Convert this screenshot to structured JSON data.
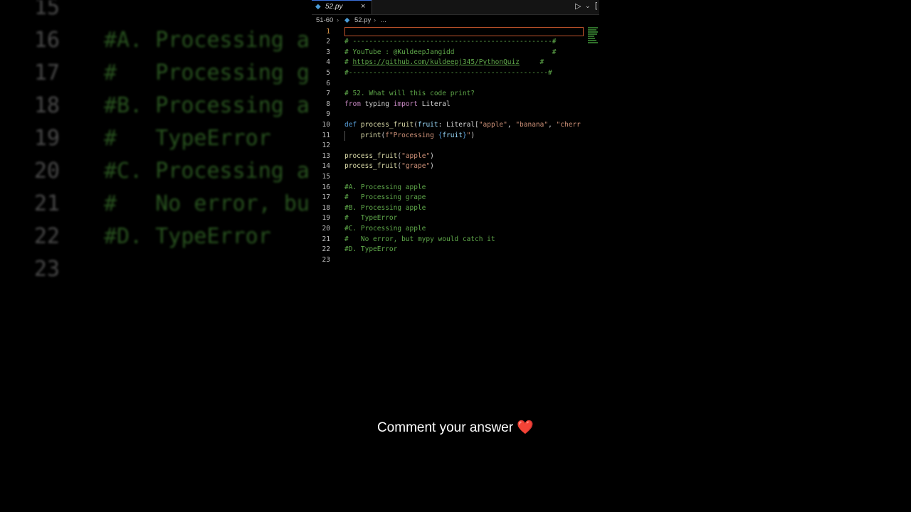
{
  "background": {
    "lines": [
      {
        "num": "15",
        "code": ""
      },
      {
        "num": "16",
        "code": "#A. Processing a"
      },
      {
        "num": "17",
        "code": "#   Processing g"
      },
      {
        "num": "18",
        "code": "#B. Processing a"
      },
      {
        "num": "19",
        "code": "#   TypeError"
      },
      {
        "num": "20",
        "code": "#C. Processing a"
      },
      {
        "num": "21",
        "code": "#   No error, bu"
      },
      {
        "num": "22",
        "code": "#D. TypeError"
      },
      {
        "num": "23",
        "code": ""
      }
    ]
  },
  "editor": {
    "tab": {
      "icon": "python-file-icon",
      "label": "52.py",
      "close": "×"
    },
    "toolbar": {
      "run": "▷",
      "run_caret": "⌄",
      "split": "[",
      "accent": "#3a6fd8"
    },
    "breadcrumb": {
      "folder": "51-60",
      "sep": "›",
      "file": "52.py",
      "rest": "..."
    },
    "lines": [
      {
        "n": "1",
        "active": true,
        "segments": []
      },
      {
        "n": "2",
        "segments": [
          {
            "t": "# -------------------------------------------------#",
            "c": "c-com"
          }
        ]
      },
      {
        "n": "3",
        "segments": [
          {
            "t": "# YouTube : @KuldeepJangidd                        #",
            "c": "c-com"
          }
        ]
      },
      {
        "n": "4",
        "segments": [
          {
            "t": "# ",
            "c": "c-com"
          },
          {
            "t": "https://github.com/kuldeepj345/PythonQuiz",
            "c": "c-link"
          },
          {
            "t": "     #",
            "c": "c-com"
          }
        ]
      },
      {
        "n": "5",
        "segments": [
          {
            "t": "#-------------------------------------------------#",
            "c": "c-com"
          }
        ]
      },
      {
        "n": "6",
        "segments": []
      },
      {
        "n": "7",
        "segments": [
          {
            "t": "# 52. What will this code print?",
            "c": "c-com"
          }
        ]
      },
      {
        "n": "8",
        "segments": [
          {
            "t": "from",
            "c": "c-kw"
          },
          {
            "t": " typing ",
            "c": "c-plain"
          },
          {
            "t": "import",
            "c": "c-kw"
          },
          {
            "t": " Literal",
            "c": "c-plain"
          }
        ]
      },
      {
        "n": "9",
        "segments": []
      },
      {
        "n": "10",
        "segments": [
          {
            "t": "def",
            "c": "c-def"
          },
          {
            "t": " ",
            "c": "c-plain"
          },
          {
            "t": "process_fruit",
            "c": "c-fn"
          },
          {
            "t": "(",
            "c": "c-plain"
          },
          {
            "t": "fruit",
            "c": "c-par"
          },
          {
            "t": ": Literal[",
            "c": "c-plain"
          },
          {
            "t": "\"apple\"",
            "c": "c-str"
          },
          {
            "t": ", ",
            "c": "c-plain"
          },
          {
            "t": "\"banana\"",
            "c": "c-str"
          },
          {
            "t": ", ",
            "c": "c-plain"
          },
          {
            "t": "\"cherr",
            "c": "c-str"
          }
        ]
      },
      {
        "n": "11",
        "guide": true,
        "segments": [
          {
            "t": "    ",
            "c": "c-plain"
          },
          {
            "t": "print",
            "c": "c-fn"
          },
          {
            "t": "(",
            "c": "c-plain"
          },
          {
            "t": "f\"Processing ",
            "c": "c-str"
          },
          {
            "t": "{",
            "c": "c-def"
          },
          {
            "t": "fruit",
            "c": "c-par"
          },
          {
            "t": "}",
            "c": "c-def"
          },
          {
            "t": "\"",
            "c": "c-str"
          },
          {
            "t": ")",
            "c": "c-plain"
          }
        ]
      },
      {
        "n": "12",
        "segments": []
      },
      {
        "n": "13",
        "segments": [
          {
            "t": "process_fruit",
            "c": "c-fn"
          },
          {
            "t": "(",
            "c": "c-plain"
          },
          {
            "t": "\"apple\"",
            "c": "c-str"
          },
          {
            "t": ")",
            "c": "c-plain"
          }
        ]
      },
      {
        "n": "14",
        "segments": [
          {
            "t": "process_fruit",
            "c": "c-fn"
          },
          {
            "t": "(",
            "c": "c-plain"
          },
          {
            "t": "\"grape\"",
            "c": "c-str"
          },
          {
            "t": ")",
            "c": "c-plain"
          }
        ]
      },
      {
        "n": "15",
        "segments": []
      },
      {
        "n": "16",
        "segments": [
          {
            "t": "#A. Processing apple",
            "c": "c-com"
          }
        ]
      },
      {
        "n": "17",
        "segments": [
          {
            "t": "#   Processing grape",
            "c": "c-com"
          }
        ]
      },
      {
        "n": "18",
        "segments": [
          {
            "t": "#B. Processing apple",
            "c": "c-com"
          }
        ]
      },
      {
        "n": "19",
        "segments": [
          {
            "t": "#   TypeError",
            "c": "c-com"
          }
        ]
      },
      {
        "n": "20",
        "segments": [
          {
            "t": "#C. Processing apple",
            "c": "c-com"
          }
        ]
      },
      {
        "n": "21",
        "segments": [
          {
            "t": "#   No error, but mypy would catch it",
            "c": "c-com"
          }
        ]
      },
      {
        "n": "22",
        "segments": [
          {
            "t": "#D. TypeError",
            "c": "c-com"
          }
        ]
      },
      {
        "n": "23",
        "segments": []
      }
    ]
  },
  "caption": {
    "text": "Comment your answer",
    "emoji": "❤️"
  }
}
